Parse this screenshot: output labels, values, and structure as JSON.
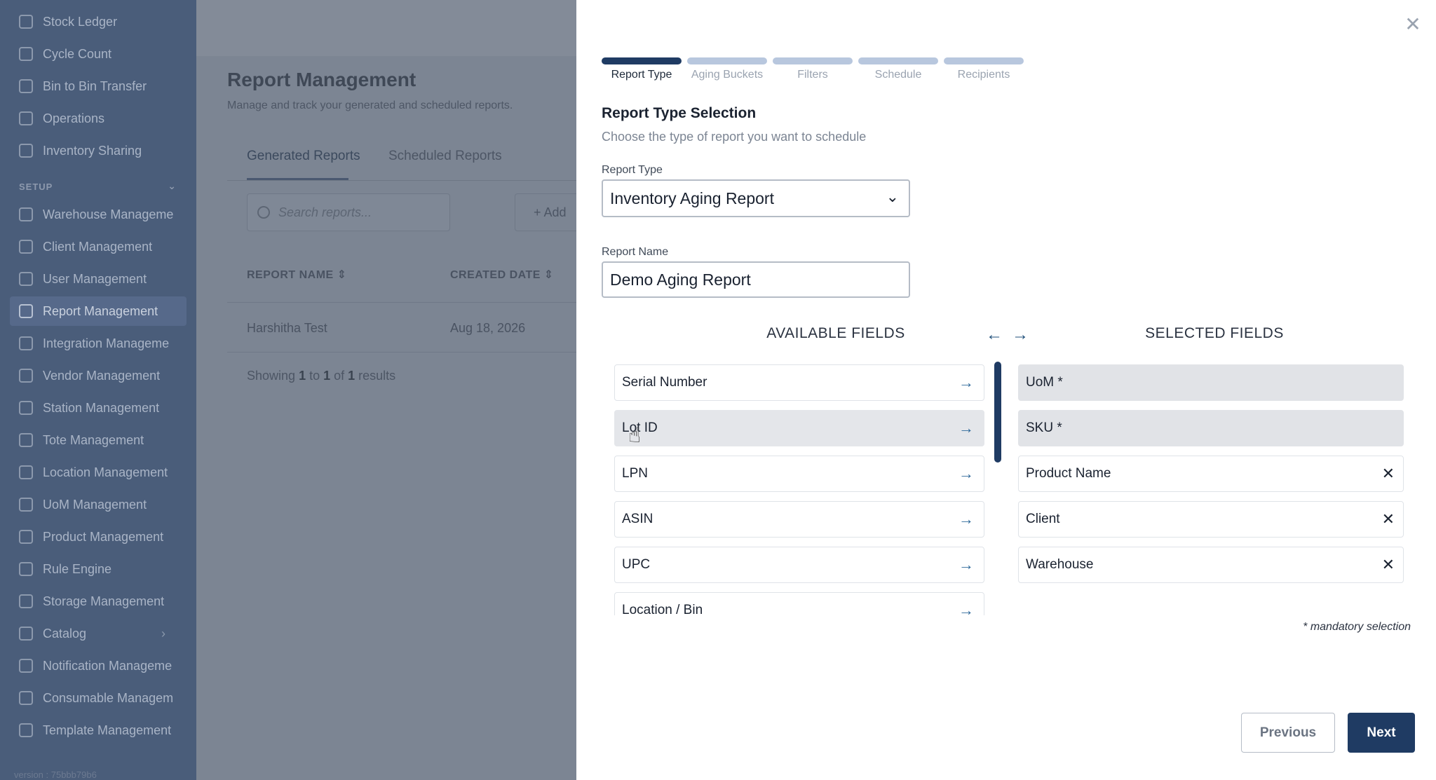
{
  "sidebar": {
    "items_top": [
      {
        "label": "Stock Ledger",
        "icon": "ledger-icon"
      },
      {
        "label": "Cycle Count",
        "icon": "refresh-icon"
      },
      {
        "label": "Bin to Bin Transfer",
        "icon": "transfer-icon"
      },
      {
        "label": "Operations",
        "icon": "cube-icon"
      },
      {
        "label": "Inventory Sharing",
        "icon": "link-icon"
      }
    ],
    "section_label": "SETUP",
    "items_setup": [
      {
        "label": "Warehouse Manageme",
        "icon": "home-icon"
      },
      {
        "label": "Client Management",
        "icon": "briefcase-icon"
      },
      {
        "label": "User Management",
        "icon": "users-icon"
      },
      {
        "label": "Report Management",
        "icon": "chart-icon",
        "active": true
      },
      {
        "label": "Integration Manageme",
        "icon": "link-icon"
      },
      {
        "label": "Vendor Management",
        "icon": "store-icon"
      },
      {
        "label": "Station Management",
        "icon": "monitor-icon"
      },
      {
        "label": "Tote Management",
        "icon": "lock-icon"
      },
      {
        "label": "Location Management",
        "icon": "building-icon"
      },
      {
        "label": "UoM Management",
        "icon": "ruler-icon"
      },
      {
        "label": "Product Management",
        "icon": "tag-icon"
      },
      {
        "label": "Rule Engine",
        "icon": "branch-icon"
      },
      {
        "label": "Storage Management",
        "icon": "grid-icon"
      },
      {
        "label": "Catalog",
        "icon": "book-icon"
      },
      {
        "label": "Notification Manageme",
        "icon": "bell-icon"
      },
      {
        "label": "Consumable Managem",
        "icon": "target-icon"
      },
      {
        "label": "Template Management",
        "icon": "template-icon"
      }
    ],
    "version": "version : 75bbb79b6"
  },
  "background_page": {
    "title": "Report Management",
    "subtitle": "Manage and track your generated and scheduled reports.",
    "tabs": [
      "Generated Reports",
      "Scheduled Reports"
    ],
    "search_placeholder": "Search reports...",
    "add_label": "+ Add",
    "columns": [
      "REPORT NAME",
      "CREATED DATE"
    ],
    "rows": [
      [
        "Harshitha Test",
        "Aug 18, 2026"
      ]
    ],
    "showing": {
      "prefix": "Showing ",
      "from": "1",
      "to_word": " to ",
      "to": "1",
      "of_word": " of ",
      "total": "1",
      "suffix": " results"
    }
  },
  "drawer": {
    "steps": [
      "Report Type",
      "Aging Buckets",
      "Filters",
      "Schedule",
      "Recipients"
    ],
    "active_step": 0,
    "section_title": "Report Type Selection",
    "section_subtitle": "Choose the type of report you want to schedule",
    "report_type_label": "Report Type",
    "report_type_value": "Inventory Aging Report",
    "report_name_label": "Report Name",
    "report_name_value": "Demo Aging Report",
    "available_heading": "AVAILABLE FIELDS",
    "selected_heading": "SELECTED FIELDS",
    "available_fields": [
      "Serial Number",
      "Lot ID",
      "LPN",
      "ASIN",
      "UPC",
      "Location / Bin"
    ],
    "hovered_available_index": 1,
    "selected_fields": [
      {
        "label": "UoM *",
        "locked": true
      },
      {
        "label": "SKU *",
        "locked": true
      },
      {
        "label": "Product Name",
        "locked": false
      },
      {
        "label": "Client",
        "locked": false
      },
      {
        "label": "Warehouse",
        "locked": false
      }
    ],
    "mandatory_note": "* mandatory selection",
    "previous_label": "Previous",
    "next_label": "Next"
  },
  "colors": {
    "accent": "#1f3b63",
    "sidebar_bg": "#4a5d7a",
    "arrow_blue": "#2f6a9b"
  }
}
